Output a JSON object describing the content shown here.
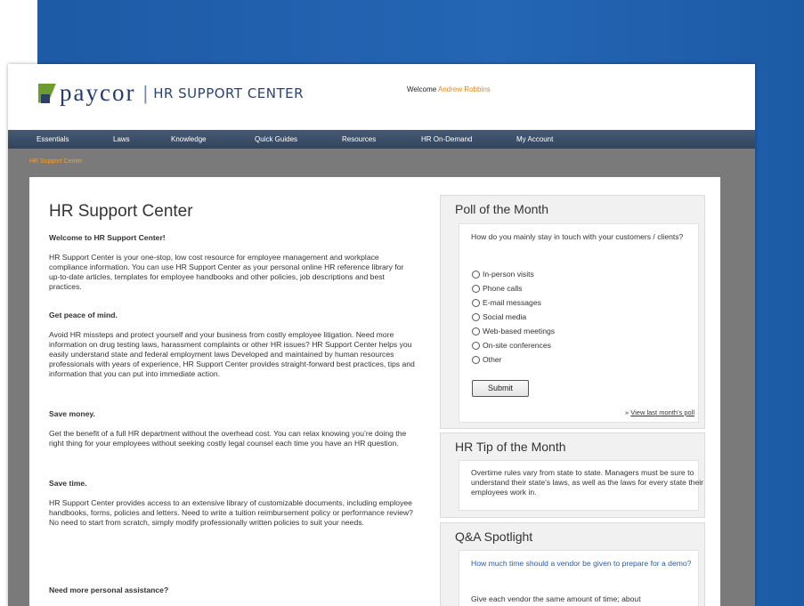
{
  "header": {
    "logo_word": "paycor",
    "logo_separator": "|",
    "logo_subtitle": "HR SUPPORT CENTER",
    "welcome_prefix": "Welcome",
    "welcome_user": "Andrew Robbins"
  },
  "nav": {
    "items": [
      "Essentials",
      "Laws",
      "Knowledge",
      "Quick Guides",
      "Resources",
      "HR On-Demand",
      "My Account"
    ]
  },
  "breadcrumb": "HR Support Center",
  "main": {
    "title": "HR Support Center",
    "sections": [
      {
        "heading": "Welcome to HR Support Center!",
        "body": "HR Support Center is your one-stop, low cost resource for employee management and workplace compliance information. You can use HR Support Center as your personal online HR reference library for up-to-date articles, templates for employee handbooks and other policies, job descriptions and best practices."
      },
      {
        "heading": "Get peace of mind.",
        "body": "Avoid HR missteps and protect yourself and your business from costly employee litigation. Need more information on drug testing laws, harassment complaints or other HR issues? HR Support Center helps you easily understand state and federal employment laws Developed and maintained by human resources professionals with years of experience, HR Support Center provides straight-forward best practices, tips and information that you can put into immediate action."
      },
      {
        "heading": "Save money.",
        "body": "Get the benefit of a full HR department without the overhead cost. You can relax knowing you’re doing the right thing for your employees without seeking costly legal counsel each time you have an HR question."
      },
      {
        "heading": "Save time.",
        "body": "HR Support Center provides access to an extensive library of customizable documents, including employee handbooks, forms, policies and letters. Need to write a tuition reimbursement policy or performance review? No need to start from scratch, simply modify professionally written policies to suit your needs."
      },
      {
        "heading": "Need more personal assistance?",
        "body": ""
      }
    ]
  },
  "poll": {
    "title": "Poll of the Month",
    "question": "How do you mainly stay in touch with your customers / clients?",
    "options": [
      "In-person visits",
      "Phone calls",
      "E-mail messages",
      "Social media",
      "Web-based meetings",
      "On-site conferences",
      "Other"
    ],
    "submit_label": "Submit",
    "view_prefix": "»",
    "view_link": "View last month's poll"
  },
  "tip": {
    "title": "HR Tip of the Month",
    "text": "Overtime rules vary from state to state. Managers must be sure to understand their state's laws, as well as the laws for every state their employees work in."
  },
  "qa": {
    "title": "Q&A Spotlight",
    "question": "How much time should a vendor be given to prepare for a demo?",
    "answer": "Give each vendor the same amount of time; about"
  }
}
